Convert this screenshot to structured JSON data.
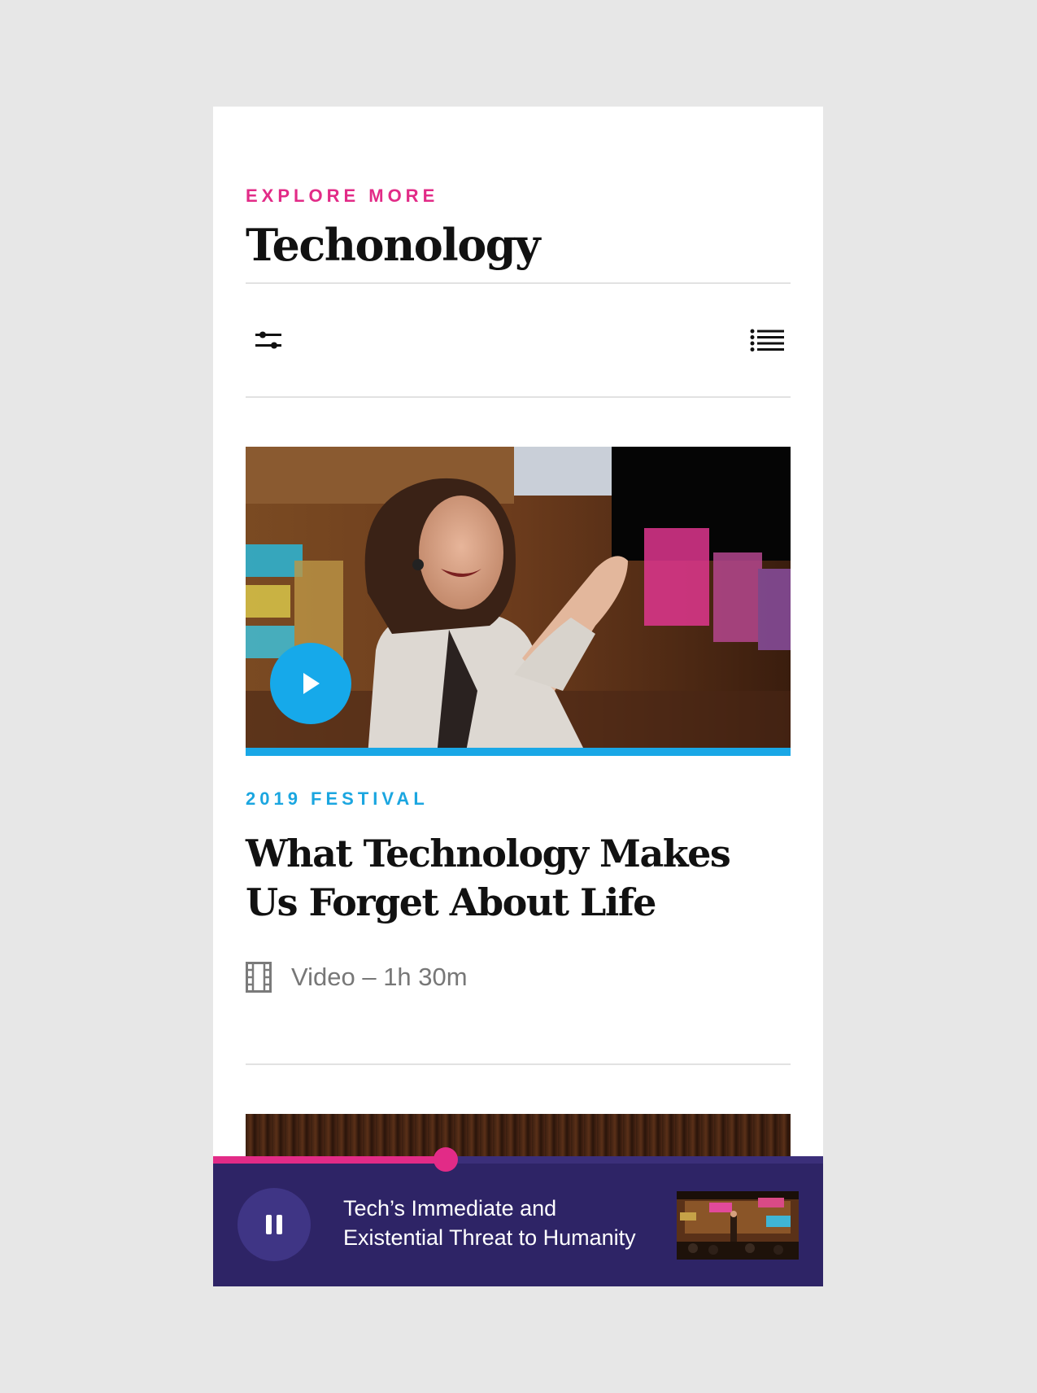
{
  "header": {
    "eyebrow": "EXPLORE MORE",
    "title": "Techonology"
  },
  "toolbar": {
    "filter_icon": "sliders-icon",
    "list_icon": "list-view-icon"
  },
  "article": {
    "category": "2019 FESTIVAL",
    "title": "What Technology Makes Us Forget About Life",
    "meta": "Video – 1h 30m",
    "meta_icon": "film-icon",
    "play_icon": "play-icon"
  },
  "player": {
    "title": "Tech’s Immediate and Existential Threat to Humanity",
    "progress": 0.381,
    "pause_icon": "pause-icon"
  },
  "colors": {
    "accent_pink": "#e22b87",
    "accent_blue": "#19a7e6",
    "player_bg": "#2e2466",
    "page_bg": "#e7e7e7"
  }
}
